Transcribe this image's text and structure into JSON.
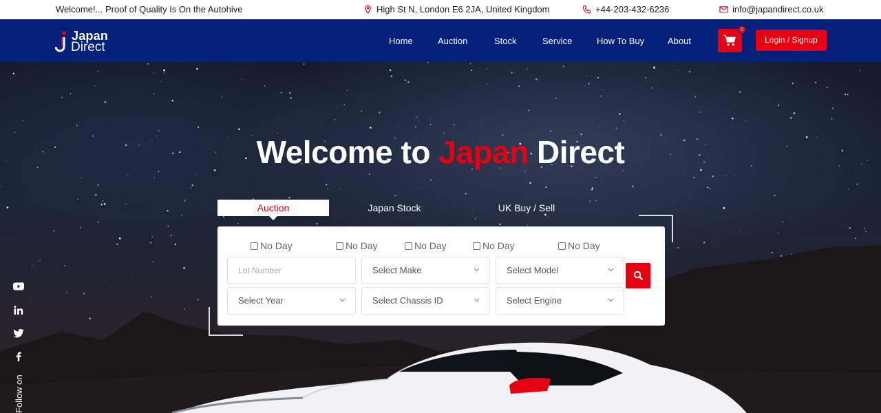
{
  "topbar": {
    "welcome": "Welcome!... Proof of Quality Is On the Autohive",
    "address": "High St N, London E6 2JA, United Kingdom",
    "phone": "+44-203-432-6236",
    "email": "info@japandirect.co.uk"
  },
  "brand": {
    "line1": "Japan",
    "line2": "Direct"
  },
  "nav": {
    "items": [
      "Home",
      "Auction",
      "Stock",
      "Service",
      "How To Buy",
      "About"
    ],
    "cart_count": "0",
    "login_label": "Login / Signup"
  },
  "hero": {
    "title_part1": "Welcome to ",
    "title_highlight": "Japan",
    "title_part2": " Direct",
    "accent_color": "#e60012"
  },
  "search": {
    "tabs": [
      "Auction",
      "Japan Stock",
      "UK Buy / Sell"
    ],
    "active_tab": "Auction",
    "checkbox_label": "No Day",
    "checkboxes": [
      "No Day",
      "No Day",
      "No Day",
      "No Day",
      "No Day"
    ],
    "lot_placeholder": "Lot Number",
    "selects": {
      "make": "Select Make",
      "model": "Select Model",
      "year": "Select Year",
      "chassis": "Select Chassis ID",
      "engine": "Select Engine"
    }
  },
  "social": {
    "label": "Follow on",
    "icons": [
      "youtube-icon",
      "linkedin-icon",
      "twitter-icon",
      "facebook-icon"
    ]
  },
  "colors": {
    "nav_bg": "#04207a",
    "accent": "#e60012"
  }
}
